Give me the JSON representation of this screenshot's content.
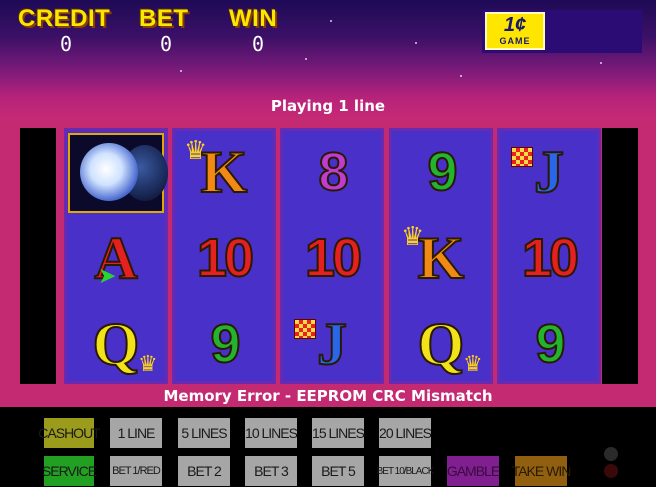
{
  "header": {
    "credit_label": "CREDIT",
    "bet_label": "BET",
    "win_label": "WIN",
    "credit_value": "0",
    "bet_value": "0",
    "win_value": "0",
    "logo_top": "1¢",
    "logo_bottom": "GAME",
    "playing_text": "Playing 1 line"
  },
  "reels": [
    [
      {
        "kind": "moon",
        "icon": "moon-icon"
      },
      {
        "label": "A",
        "color": "red",
        "icon": "arrow-icon"
      },
      {
        "label": "Q",
        "color": "yellow",
        "icon": "crown-icon"
      }
    ],
    [
      {
        "label": "K",
        "color": "orange",
        "icon": "crown-icon"
      },
      {
        "label": "10",
        "color": "red"
      },
      {
        "label": "9",
        "color": "green"
      }
    ],
    [
      {
        "label": "8",
        "color": "purple"
      },
      {
        "label": "10",
        "color": "red"
      },
      {
        "label": "J",
        "color": "blue",
        "icon": "badge-icon"
      }
    ],
    [
      {
        "label": "9",
        "color": "green"
      },
      {
        "label": "K",
        "color": "orange",
        "icon": "crown-icon"
      },
      {
        "label": "Q",
        "color": "yellow",
        "icon": "crown-icon"
      }
    ],
    [
      {
        "label": "J",
        "color": "blue",
        "icon": "badge-icon"
      },
      {
        "label": "10",
        "color": "red"
      },
      {
        "label": "9",
        "color": "green"
      }
    ]
  ],
  "message": "Memory Error - EEPROM CRC Mismatch",
  "buttons": {
    "row1": [
      "CASHOUT",
      "1 LINE",
      "5 LINES",
      "10 LINES",
      "15 LINES",
      "20 LINES"
    ],
    "row2": [
      "SERVICE",
      "BET 1/RED",
      "BET 2",
      "BET 3",
      "BET 5",
      "BET 10/BLACK",
      "GAMBLE",
      "TAKE WIN"
    ]
  },
  "colors": {
    "header_text": "#f7e800",
    "frame": "#c42a72",
    "reel_bg": "#4830c8",
    "cashout": "#9b9b1c",
    "service": "#22a022",
    "gamble": "#802090",
    "take_win": "#906010",
    "line_buttons": "#a6a6a6"
  }
}
